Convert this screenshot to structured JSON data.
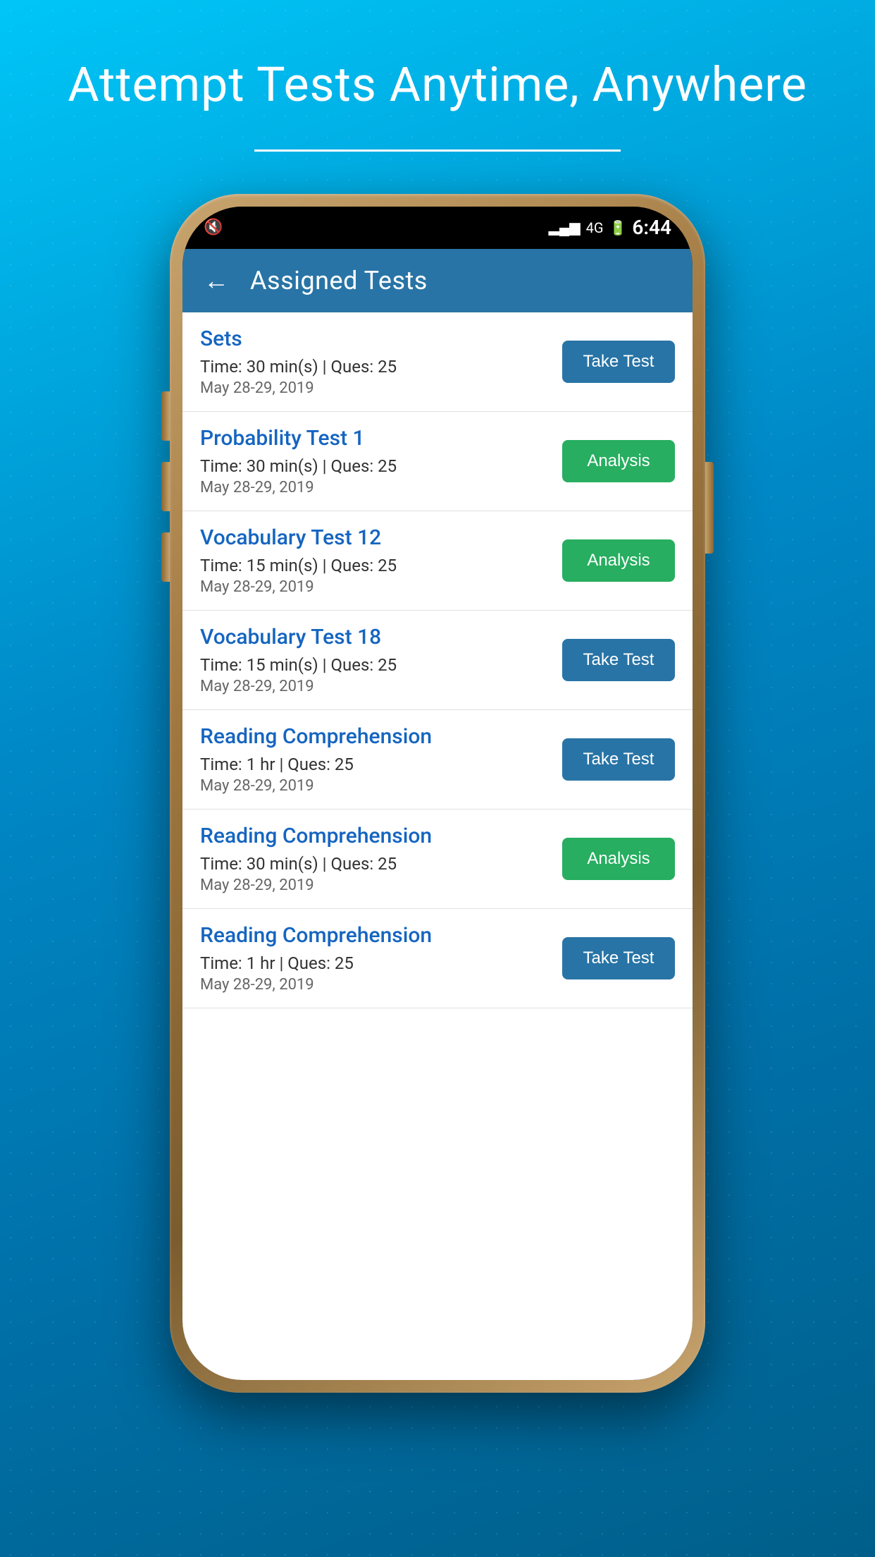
{
  "hero": {
    "title": "Attempt Tests Anytime, Anywhere"
  },
  "phone": {
    "status_bar": {
      "time": "6:44",
      "signal": "4G",
      "battery_icon": "⚡"
    },
    "header": {
      "title": "Assigned Tests",
      "back_label": "←"
    },
    "tests": [
      {
        "id": 1,
        "title": "Sets",
        "time": "Time: 30 min(s) | Ques: 25",
        "date": "May 28-29, 2019",
        "button_type": "take",
        "button_label": "Take Test"
      },
      {
        "id": 2,
        "title": "Probability Test 1",
        "time": "Time: 30 min(s) | Ques: 25",
        "date": "May 28-29, 2019",
        "button_type": "analysis",
        "button_label": "Analysis"
      },
      {
        "id": 3,
        "title": "Vocabulary Test 12",
        "time": "Time: 15 min(s) | Ques: 25",
        "date": "May 28-29, 2019",
        "button_type": "analysis",
        "button_label": "Analysis"
      },
      {
        "id": 4,
        "title": "Vocabulary Test 18",
        "time": "Time: 15 min(s) | Ques: 25",
        "date": "May 28-29, 2019",
        "button_type": "take",
        "button_label": "Take Test"
      },
      {
        "id": 5,
        "title": "Reading Comprehension",
        "time": "Time: 1 hr | Ques: 25",
        "date": "May 28-29, 2019",
        "button_type": "take",
        "button_label": "Take Test"
      },
      {
        "id": 6,
        "title": "Reading Comprehension",
        "time": "Time: 30 min(s) | Ques: 25",
        "date": "May 28-29, 2019",
        "button_type": "analysis",
        "button_label": "Analysis"
      },
      {
        "id": 7,
        "title": "Reading Comprehension",
        "time": "Time: 1 hr | Ques: 25",
        "date": "May 28-29, 2019",
        "button_type": "take",
        "button_label": "Take Test"
      }
    ]
  }
}
